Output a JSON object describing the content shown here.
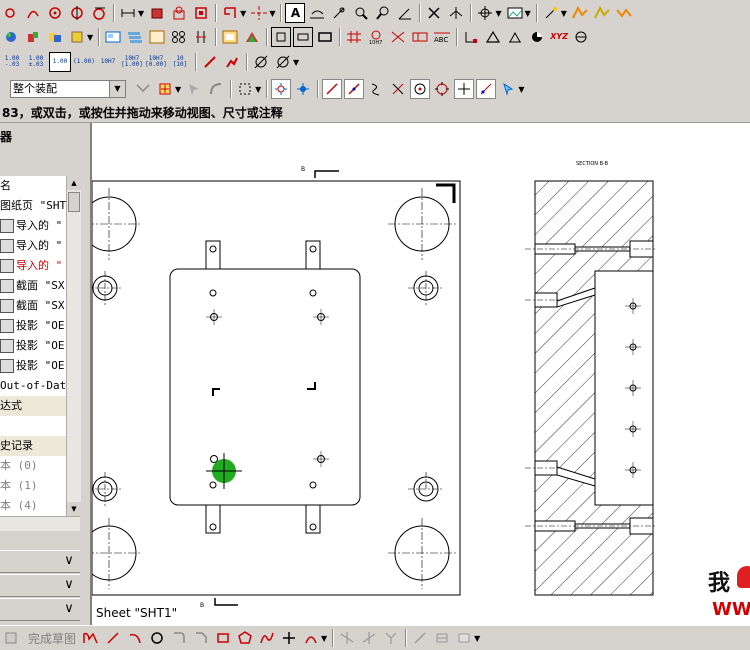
{
  "toolbar": {
    "assembly_combo_value": "整个装配",
    "tiny_labels": [
      "1.00\n-.03",
      "1.00\n±.03",
      "1.00",
      "(1.00)",
      "10H7",
      "10H7\n[1.00]",
      "10H7\n[0.00]",
      "10\n[10]"
    ]
  },
  "status_prompt": "83，或双击，或按住并拖动来移动视图、尺寸或注释",
  "navigator": {
    "title": "器",
    "items": [
      {
        "label": "图纸页 \"SHT",
        "state": "normal"
      },
      {
        "label": "导入的 \"",
        "state": "normal"
      },
      {
        "label": "导入的 \"",
        "state": "normal"
      },
      {
        "label": "导入的 \"",
        "state": "selected"
      },
      {
        "label": "截面 \"SX",
        "state": "normal"
      },
      {
        "label": "截面 \"SX",
        "state": "normal"
      },
      {
        "label": "投影 \"OE",
        "state": "normal"
      },
      {
        "label": "投影 \"OE",
        "state": "normal"
      },
      {
        "label": "投影 \"OE",
        "state": "normal"
      },
      {
        "label": "Out-of-Date",
        "state": "normal"
      },
      {
        "label": "达式",
        "state": "section"
      },
      {
        "label": "",
        "state": "blank"
      },
      {
        "label": "史记录",
        "state": "section"
      },
      {
        "label": "本 (0)",
        "state": "dim"
      },
      {
        "label": "本 (1)",
        "state": "dim"
      },
      {
        "label": "本 (4)",
        "state": "dim"
      }
    ],
    "top_label": "器"
  },
  "drawing": {
    "sheet_label": "Sheet \"SHT1\"",
    "section_title": "SECTION B-B",
    "marker_top": "B",
    "marker_bottom": "B"
  },
  "bottom": {
    "finish_sketch_label": "完成草图"
  },
  "watermark": {
    "text": "我",
    "url_fragment": "WW"
  },
  "colors": {
    "chrome": "#d6d3ce",
    "selected_text": "#cc0000",
    "cursor_green": "#22aa22"
  }
}
